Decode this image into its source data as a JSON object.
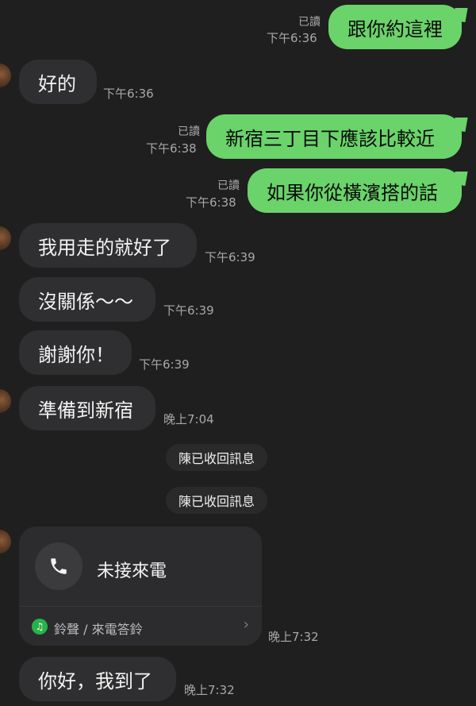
{
  "messages": {
    "m1": {
      "text": "跟你約這裡",
      "read": "已讀",
      "time": "下午6:36"
    },
    "m2": {
      "text": "好的",
      "time": "下午6:36"
    },
    "m3": {
      "text": "新宿三丁目下應該比較近",
      "read": "已讀",
      "time": "下午6:38"
    },
    "m4": {
      "text": "如果你從橫濱搭的話",
      "read": "已讀",
      "time": "下午6:38"
    },
    "m5": {
      "text": "我用走的就好了",
      "time": "下午6:39"
    },
    "m6": {
      "text": "沒關係～～",
      "time": "下午6:39"
    },
    "m7": {
      "text": "謝謝你！",
      "time": "下午6:39"
    },
    "m8": {
      "text": "準備到新宿",
      "time": "晚上7:04"
    },
    "sys1": {
      "text": "陳已收回訊息"
    },
    "sys2": {
      "text": "陳已收回訊息"
    },
    "call": {
      "title": "未接來電",
      "ring_label": "鈴聲 / 來電答鈴",
      "time": "晚上7:32"
    },
    "m9": {
      "text": "你好，我到了",
      "time": "晚上7:32"
    }
  },
  "icons": {
    "phone": "phone-icon",
    "ring": "music-note-icon",
    "chevron": "chevron-right-icon"
  },
  "colors": {
    "background": "#1f1f1f",
    "incoming_bubble": "#2f2f31",
    "outgoing_bubble": "#6ad36a",
    "meta_text": "#a8a8a8"
  }
}
